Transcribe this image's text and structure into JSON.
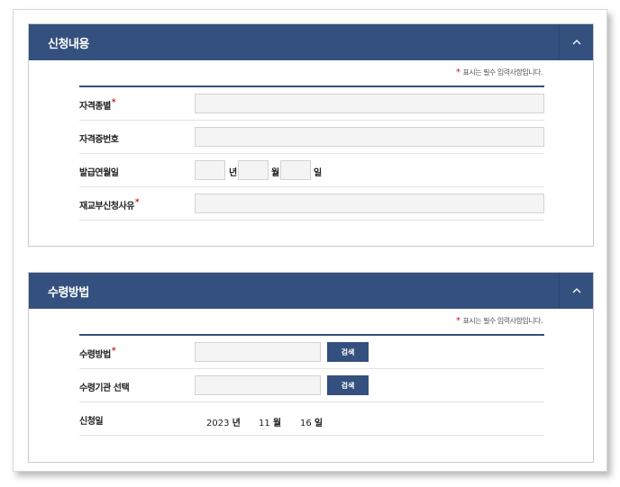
{
  "section1": {
    "title": "신청내용",
    "required_note": "표시는 필수 입력사항입니다.",
    "fields": [
      {
        "label": "자격종별",
        "required": true
      },
      {
        "label": "자격증번호",
        "required": false
      },
      {
        "label": "발급연월일",
        "required": false
      },
      {
        "label": "재교부신청사유",
        "required": true
      }
    ],
    "date_units": {
      "year": "년",
      "month": "월",
      "day": "일"
    }
  },
  "section2": {
    "title": "수령방법",
    "required_note": "표시는 필수 입력사항입니다.",
    "fields": [
      {
        "label": "수령방법",
        "required": true,
        "button": "검색"
      },
      {
        "label": "수령기관 선택",
        "required": false,
        "button": "검색"
      },
      {
        "label": "신청일",
        "required": false
      }
    ],
    "apply_date": {
      "year": "2023",
      "year_unit": "년",
      "month": "11",
      "month_unit": "월",
      "day": "16",
      "day_unit": "일"
    }
  },
  "colors": {
    "header_bg": "#34507e",
    "required_star": "#c8141e",
    "input_bg": "#f4f4f4"
  },
  "icons": {
    "collapse": "chevron-up-icon"
  }
}
